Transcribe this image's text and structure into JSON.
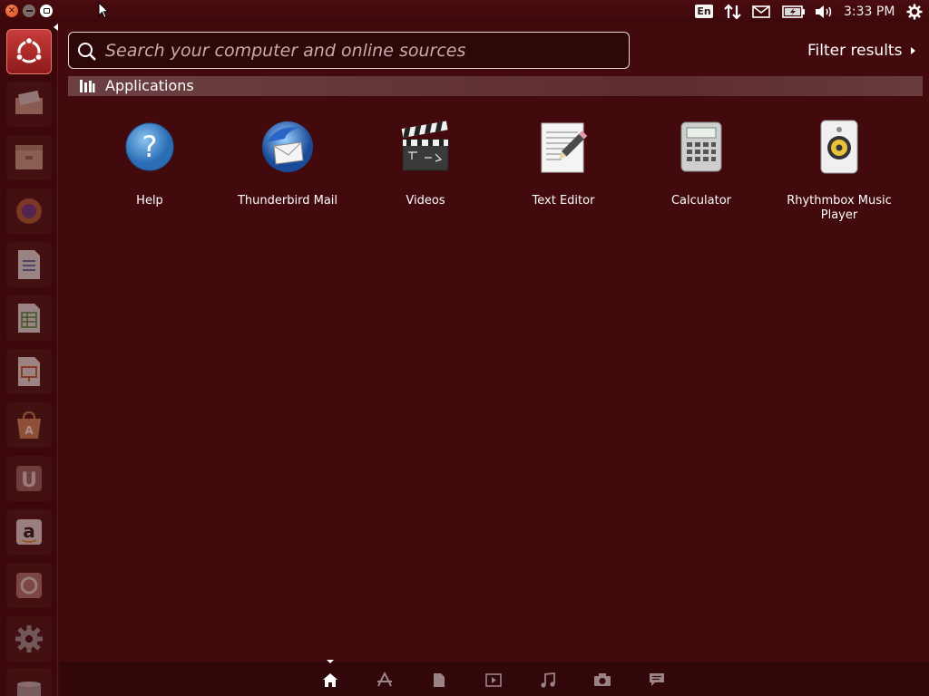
{
  "panel": {
    "keyboard_layout": "En",
    "clock": "3:33 PM",
    "icons": [
      "close-icon",
      "minimize-icon",
      "maximize-icon",
      "keyboard-indicator-icon",
      "network-icon",
      "mail-icon",
      "battery-icon",
      "sound-icon",
      "session-gear-icon"
    ]
  },
  "launcher": {
    "items": [
      "dash-home",
      "files",
      "file-manager",
      "firefox",
      "libreoffice-writer",
      "libreoffice-calc",
      "libreoffice-impress",
      "ubuntu-software-center",
      "ubuntu-one",
      "amazon",
      "ubuntu-one-music",
      "system-settings",
      "trash"
    ]
  },
  "search": {
    "placeholder": "Search your computer and online sources",
    "value": ""
  },
  "filter": {
    "label": "Filter results"
  },
  "category": {
    "title": "Applications",
    "apps": [
      {
        "label": "Help",
        "icon": "help-icon"
      },
      {
        "label": "Thunderbird Mail",
        "icon": "thunderbird-icon"
      },
      {
        "label": "Videos",
        "icon": "clapperboard-icon"
      },
      {
        "label": "Text Editor",
        "icon": "text-editor-icon"
      },
      {
        "label": "Calculator",
        "icon": "calculator-icon"
      },
      {
        "label": "Rhythmbox Music Player",
        "icon": "speaker-icon"
      }
    ]
  },
  "lenses": [
    "home",
    "applications",
    "files",
    "videos",
    "music",
    "photos",
    "social"
  ],
  "colors": {
    "background": "#430a0d",
    "accent": "#d94715"
  }
}
